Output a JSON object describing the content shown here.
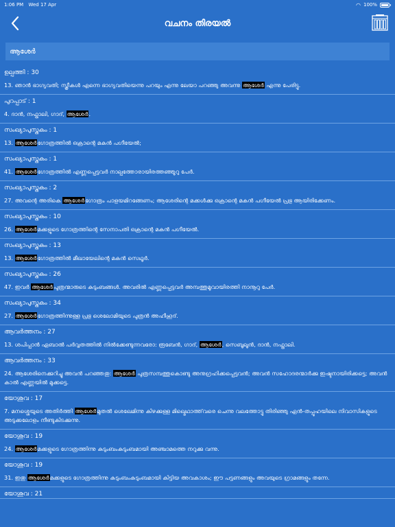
{
  "status": {
    "time": "1:06 PM",
    "date": "Wed 17 Apr",
    "battery": "100%"
  },
  "nav": {
    "title": "വചനം തിരയൽ"
  },
  "search": {
    "query": "ആശേർ"
  },
  "results": [
    {
      "ref": "ഉല്പത്തി : 30",
      "pre": "13. ഞാൻ ഭാഗ്യവതി; സ്ത്രീകൾ എന്നെ ഭാഗ്യവതിയെന്നു പറയും എന്നു ലേയാ പറഞ്ഞു അവന്നു ",
      "hl": "ആശേർ",
      "post": " എന്നു പേരിട്ടു."
    },
    {
      "ref": "പുറപ്പാട് : 1",
      "pre": "4. ദാൻ, നഫ്താലി, ഗാദ്, ",
      "hl": "ആശേർ",
      "post": "."
    },
    {
      "ref": "സംഖ്യാപുസ്തകം : 1",
      "pre": "13. ",
      "hl": "ആശേർ",
      "post": "ഗോത്രത്തിൽ ഒക്രാന്റെ മകൻ പഗീയേൽ;"
    },
    {
      "ref": "സംഖ്യാപുസ്തകം : 1",
      "pre": "41. ",
      "hl": "ആശേർ",
      "post": "ഗോത്രത്തിൽ എണ്ണപ്പെട്ടവർ നാല്പത്തോരായിരത്തഞ്ഞൂറു പേർ."
    },
    {
      "ref": "സംഖ്യാപുസ്തകം : 2",
      "pre": "27. അവന്റെ അരികെ ",
      "hl": "ആശേർ",
      "post": "ഗോത്രം പാളയമിറങ്ങേണം; ആശേരിന്റെ മക്കൾക്കു ഒക്രാന്റെ മകൻ പഗീയേൽ പ്രഭു ആയിരിക്കേണം."
    },
    {
      "ref": "സംഖ്യാപുസ്തകം : 10",
      "pre": "26. ",
      "hl": "ആശേർ",
      "post": "മക്കളുടെ ഗോത്രത്തിന്റെ സേനാപതി ഒക്രാന്റെ മകൻ പഗീയേൽ."
    },
    {
      "ref": "സംഖ്യാപുസ്തകം : 13",
      "pre": "13. ",
      "hl": "ആശേർ",
      "post": "ഗോത്രത്തിൽ മീഖായേലിന്റെ മകൻ സെഥൂർ."
    },
    {
      "ref": "സംഖ്യാപുസ്തകം : 26",
      "pre": "47. ഇവർ ",
      "hl": "ആശേർ",
      "post": "പുത്രന്മാരുടെ കുടുംബങ്ങൾ. അവരിൽ എണ്ണപ്പെട്ടവർ അമ്പത്തുമൂവായിരത്തി നാനൂറു പേർ."
    },
    {
      "ref": "സംഖ്യാപുസ്തകം : 34",
      "pre": "27. ",
      "hl": "ആശേർ",
      "post": "ഗോത്രത്തിന്നുള്ള പ്രഭു ശെലോമിയുടെ പുത്രൻ അഹീഹൂദ്."
    },
    {
      "ref": "ആവർത്തനം : 27",
      "pre": "13. ശപിപ്പാൻ ഏബാൽ പർവ്വതത്തിൽ നിൽക്കേണ്ടുന്നവരോ: രൂബേൻ, ഗാദ്, ",
      "hl": "ആശേർ",
      "post": ", സെബൂലൂൻ, ദാൻ, നഫ്താലി."
    },
    {
      "ref": "ആവർത്തനം : 33",
      "pre": "24. ആശേരിനെക്കുറിച്ചു അവൻ പറഞ്ഞതു: ",
      "hl": "ആശേർ",
      "post": " പുത്രസമ്പത്തുകൊണ്ടു അനുഗ്രഹിക്കപ്പെട്ടവൻ; അവൻ സഹോദരന്മാർക്കു ഇഷ്ടനായിരിക്കട്ടെ; അവൻ കാൽ എണ്ണയിൽ മുക്കട്ടെ."
    },
    {
      "ref": "യോശുവ : 17",
      "pre": "7. മനശ്ശെയുടെ അതിർത്തി ",
      "hl": "ആശേർ",
      "post": "മുതൽ ശെഖേമിന്നു കിഴക്കുള്ള മിഖ്മെഥാത്ത്‌വരെ ചെന്നു വലത്തോട്ടു തിരിഞ്ഞു ഏൻ-തപ്പൂഹയിലെ നിവാസികളുടെ അടുക്കലോളം നീണ്ടുകിടക്കുന്നു."
    },
    {
      "ref": "യോശുവ : 19",
      "pre": "24. ",
      "hl": "ആശേർ",
      "post": "മക്കളുടെ ഗോത്രത്തിന്നു കുടുംബംകുടുംബമായി അഞ്ചാമത്തെ നറുക്കു വന്നു."
    },
    {
      "ref": "യോശുവ : 19",
      "pre": "31. ഇതു ",
      "hl": "ആശേർ",
      "post": "മക്കളുടെ ഗോത്രത്തിന്നു കുടുംബംകുടുംബമായി കിട്ടിയ അവകാശം; ഈ പട്ടണങ്ങളും അവയുടെ ഗ്രാമങ്ങളും തന്നേ."
    },
    {
      "ref": "യോശുവ : 21",
      "pre": "",
      "hl": "",
      "post": ""
    }
  ]
}
